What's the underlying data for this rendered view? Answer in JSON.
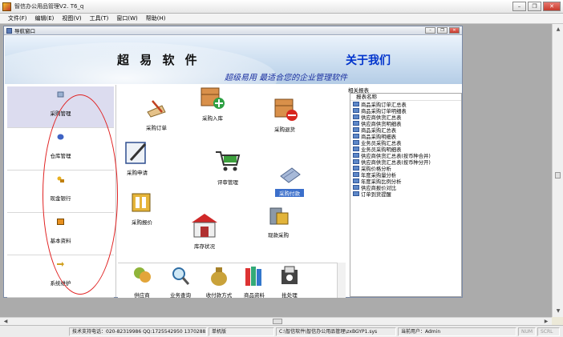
{
  "window": {
    "title": "智信办公用品管理V2. T6_q",
    "controls": {
      "minimize": "–",
      "restore": "❐",
      "close": "✕"
    }
  },
  "menu": [
    "文件(F)",
    "编辑(E)",
    "视图(V)",
    "工具(T)",
    "窗口(W)",
    "帮助(H)"
  ],
  "child_window": {
    "title": "导航窗口",
    "banner": {
      "brand": "超 易 软 件",
      "about": "关于我们",
      "slogan": "超级易用  最适合您的企业管理软件"
    },
    "nav": [
      {
        "label": "采购管理",
        "icon": "purchase-icon",
        "active": true
      },
      {
        "label": "仓库管理",
        "icon": "warehouse-icon",
        "active": false
      },
      {
        "label": "现金银行",
        "icon": "cash-bank-icon",
        "active": false
      },
      {
        "label": "基本资料",
        "icon": "basic-data-icon",
        "active": false
      },
      {
        "label": "系统维护",
        "icon": "system-maintenance-icon",
        "active": false
      }
    ],
    "functions": {
      "order": "采购订单",
      "inbound": "采购入库",
      "return": "采购退货",
      "request": "采购申请",
      "review": "评审管理",
      "payment": "采购付款",
      "quote": "采购报价",
      "stock": "库存状况",
      "cash_purchase": "现款采购"
    },
    "lower": [
      "供应商",
      "业务查询",
      "收付款方式",
      "商品资料",
      "批处理"
    ],
    "reports": {
      "section_title": "相关报表",
      "header": "报表名称",
      "items": [
        "商品采购订单汇总表",
        "商品采购订单明细表",
        "供应商供货汇总表",
        "供应商供货明细表",
        "商品采购汇总表",
        "商品采购明细表",
        "业务员采购汇总表",
        "业务员采购明细表",
        "供应商供货汇总表(按币种合并)",
        "供应商供货汇总表(按币种分开)",
        "采购价格分析",
        "年度采购量分析",
        "年度采购比例分析",
        "供应商报价对比",
        "订单到货提醒"
      ]
    }
  },
  "status": {
    "support": "技术支持电话：020-82319986 QQ:1725542950 137028856",
    "version": "单机版",
    "path": "C:\\智信软件\\智信办公用品管理\\zxBGYP1.sys",
    "user": "当前用户：Admin",
    "num": "NUM",
    "scrl": "SCRL"
  },
  "colors": {
    "accent": "#0033CC",
    "slogan": "#1A2FA0",
    "highlight": "#3B6FCB",
    "annotation": "#E02020"
  }
}
